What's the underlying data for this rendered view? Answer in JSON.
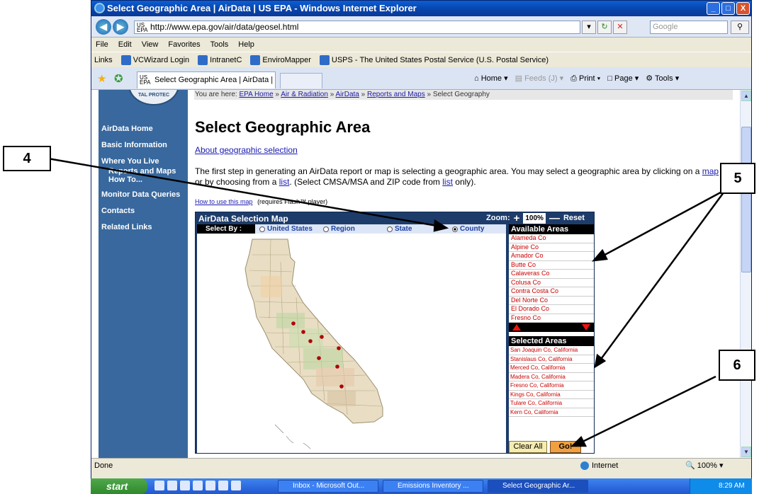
{
  "window": {
    "title": "Select Geographic Area | AirData | US EPA - Windows Internet Explorer",
    "controls": [
      "_",
      "□",
      "X"
    ]
  },
  "address_bar": {
    "favicon": "US EPA",
    "url": "http://www.epa.gov/air/data/geosel.html",
    "search_placeholder": "Google"
  },
  "menu": [
    "File",
    "Edit",
    "View",
    "Favorites",
    "Tools",
    "Help"
  ],
  "links_bar": {
    "label": "Links",
    "items": [
      "VCWizard Login",
      "IntranetC",
      "EnviroMapper",
      "USPS - The United States Postal Service (U.S. Postal Service)"
    ]
  },
  "tab": {
    "title": "Select Geographic Area | AirData | US EPA"
  },
  "command_bar": {
    "home": "Home",
    "feeds": "Feeds (J)",
    "print": "Print",
    "page": "Page",
    "tools": "Tools"
  },
  "sidebar": {
    "seal_text": "TAL PROTEC",
    "items": [
      "AirData Home",
      "Basic Information",
      "Where You Live",
      "Reports and Maps",
      "How To...",
      "Monitor Data Queries",
      "Contacts",
      "Related Links"
    ]
  },
  "breadcrumb": {
    "prefix": "You are here:",
    "links": [
      "EPA Home",
      "Air & Radiation",
      "AirData",
      "Reports and Maps"
    ],
    "current": "Select Geography",
    "separator": "»"
  },
  "page": {
    "title": "Select Geographic Area",
    "about_link": "About geographic selection",
    "intro_part1": "The first step in generating an AirData report or map is selecting a geographic area. You may select a geographic area by clicking on a ",
    "intro_map_link": "map",
    "intro_part2": " or by choosing from a ",
    "intro_list_link": "list",
    "intro_part3": ". (Select CMSA/MSA and ZIP code from ",
    "intro_list_link2": "list",
    "intro_part4": " only).",
    "howto_link": "How to use this map",
    "howto_note": "(requires Flash™ player)"
  },
  "map": {
    "title": "AirData Selection Map",
    "zoom_label": "Zoom:",
    "zoom_level": "100%",
    "reset_label": "Reset",
    "select_by_label": "Select By :",
    "options": [
      "United States",
      "Region",
      "State",
      "County"
    ],
    "selected_option": "County"
  },
  "available_areas": {
    "header": "Available Areas",
    "items": [
      "Alameda Co",
      "Alpine Co",
      "Amador Co",
      "Butte Co",
      "Calaveras Co",
      "Colusa Co",
      "Contra Costa Co",
      "Del Norte Co",
      "El Dorado Co",
      "Fresno Co"
    ]
  },
  "selected_areas": {
    "header": "Selected Areas",
    "items": [
      "San Joaquin Co, California",
      "Stanislaus Co, California",
      "Merced Co, California",
      "Madera Co, California",
      "Fresno Co, California",
      "Kings Co, California",
      "Tulare Co, California",
      "Kern Co, California"
    ],
    "clear_label": "Clear All",
    "go_label": "Go!"
  },
  "status": {
    "text": "Done",
    "zone": "Internet",
    "zoom": "100%"
  },
  "taskbar": {
    "start": "start",
    "tasks": [
      "Inbox - Microsoft Out...",
      "Emissions Inventory ...",
      "Select Geographic Ar..."
    ],
    "clock": "8:29 AM"
  },
  "callouts": [
    "4",
    "5",
    "6"
  ],
  "colors": {
    "sidebar": "#38689d",
    "map_frame": "#1d3c6a",
    "area_text": "#cc0000",
    "callout_line": "#000000"
  }
}
